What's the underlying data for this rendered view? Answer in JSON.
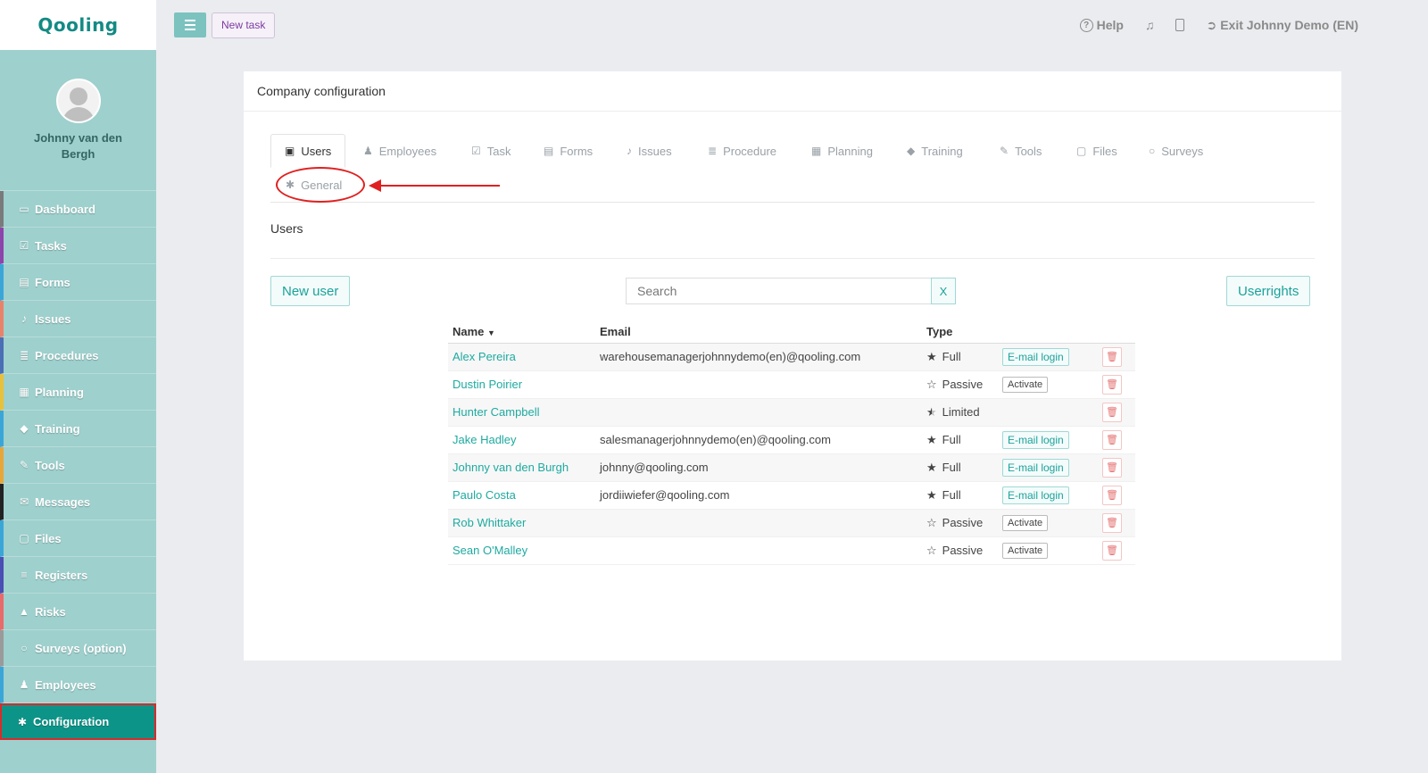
{
  "app": {
    "logo": "Qooling"
  },
  "user": {
    "name": "Johnny van den Bergh"
  },
  "sidebar": {
    "items": [
      {
        "label": "Dashboard",
        "icon": "monitor-icon",
        "glyph": "▭",
        "color": "#7a7a7a"
      },
      {
        "label": "Tasks",
        "icon": "check-square-icon",
        "glyph": "☑",
        "color": "#8e44ad"
      },
      {
        "label": "Forms",
        "icon": "document-icon",
        "glyph": "▤",
        "color": "#3aa6d8"
      },
      {
        "label": "Issues",
        "icon": "bell-icon",
        "glyph": "♪",
        "color": "#e8836a"
      },
      {
        "label": "Procedures",
        "icon": "list-icon",
        "glyph": "≣",
        "color": "#4a6fb5"
      },
      {
        "label": "Planning",
        "icon": "calendar-icon",
        "glyph": "▦",
        "color": "#e8c13a"
      },
      {
        "label": "Training",
        "icon": "graduation-cap-icon",
        "glyph": "◆",
        "color": "#3aa6d8"
      },
      {
        "label": "Tools",
        "icon": "wrench-icon",
        "glyph": "✎",
        "color": "#e8a63a"
      },
      {
        "label": "Messages",
        "icon": "envelope-icon",
        "glyph": "✉",
        "color": "#222222"
      },
      {
        "label": "Files",
        "icon": "file-icon",
        "glyph": "▢",
        "color": "#3aa6d8"
      },
      {
        "label": "Registers",
        "icon": "registers-icon",
        "glyph": "≡",
        "color": "#4a4fb5"
      },
      {
        "label": "Risks",
        "icon": "warning-icon",
        "glyph": "▲",
        "color": "#e86a6a"
      },
      {
        "label": "Surveys (option)",
        "icon": "speech-bubble-icon",
        "glyph": "○",
        "color": "#9a9a9a"
      },
      {
        "label": "Employees",
        "icon": "users-icon",
        "glyph": "♟",
        "color": "#3aa6d8"
      },
      {
        "label": "Configuration",
        "icon": "gear-icon",
        "glyph": "✱",
        "color": "#0d9488",
        "active": true
      }
    ]
  },
  "topbar": {
    "new_task": "New task",
    "help": "Help",
    "exit": "Exit Johnny Demo (EN)"
  },
  "panel": {
    "title": "Company configuration",
    "tabs": [
      {
        "label": "Users",
        "icon": "id-card-icon",
        "glyph": "▣",
        "active": true
      },
      {
        "label": "Employees",
        "icon": "users-icon",
        "glyph": "♟"
      },
      {
        "label": "Task",
        "icon": "check-square-icon",
        "glyph": "☑"
      },
      {
        "label": "Forms",
        "icon": "document-icon",
        "glyph": "▤"
      },
      {
        "label": "Issues",
        "icon": "bell-icon",
        "glyph": "♪"
      },
      {
        "label": "Procedure",
        "icon": "list-icon",
        "glyph": "≣"
      },
      {
        "label": "Planning",
        "icon": "calendar-icon",
        "glyph": "▦"
      },
      {
        "label": "Training",
        "icon": "graduation-cap-icon",
        "glyph": "◆"
      },
      {
        "label": "Tools",
        "icon": "wrench-icon",
        "glyph": "✎"
      },
      {
        "label": "Files",
        "icon": "file-icon",
        "glyph": "▢"
      },
      {
        "label": "Surveys",
        "icon": "speech-bubble-icon",
        "glyph": "○"
      },
      {
        "label": "General",
        "icon": "gear-icon",
        "glyph": "✱"
      }
    ],
    "section_title": "Users",
    "new_user": "New user",
    "search_placeholder": "Search",
    "search_clear": "X",
    "userrights": "Userrights",
    "table": {
      "headers": {
        "name": "Name",
        "email": "Email",
        "type": "Type"
      },
      "rows": [
        {
          "name": "Alex Pereira",
          "email": "warehousemanagerjohnnydemo(en)@qooling.com",
          "type": "Full",
          "star": "full",
          "action": "E-mail login"
        },
        {
          "name": "Dustin Poirier",
          "email": "",
          "type": "Passive",
          "star": "empty",
          "action": "Activate"
        },
        {
          "name": "Hunter Campbell",
          "email": "",
          "type": "Limited",
          "star": "half",
          "action": ""
        },
        {
          "name": "Jake Hadley",
          "email": "salesmanagerjohnnydemo(en)@qooling.com",
          "type": "Full",
          "star": "full",
          "action": "E-mail login"
        },
        {
          "name": "Johnny van den Burgh",
          "email": "johnny@qooling.com",
          "type": "Full",
          "star": "full",
          "action": "E-mail login"
        },
        {
          "name": "Paulo Costa",
          "email": "jordiiwiefer@qooling.com",
          "type": "Full",
          "star": "full",
          "action": "E-mail login"
        },
        {
          "name": "Rob Whittaker",
          "email": "",
          "type": "Passive",
          "star": "empty",
          "action": "Activate"
        },
        {
          "name": "Sean O'Malley",
          "email": "",
          "type": "Passive",
          "star": "empty",
          "action": "Activate"
        }
      ]
    }
  },
  "colors": {
    "accent": "#1eaaa0",
    "sidebar": "#9ed0cd",
    "active_nav": "#0d9488",
    "annotation": "#e02020"
  }
}
